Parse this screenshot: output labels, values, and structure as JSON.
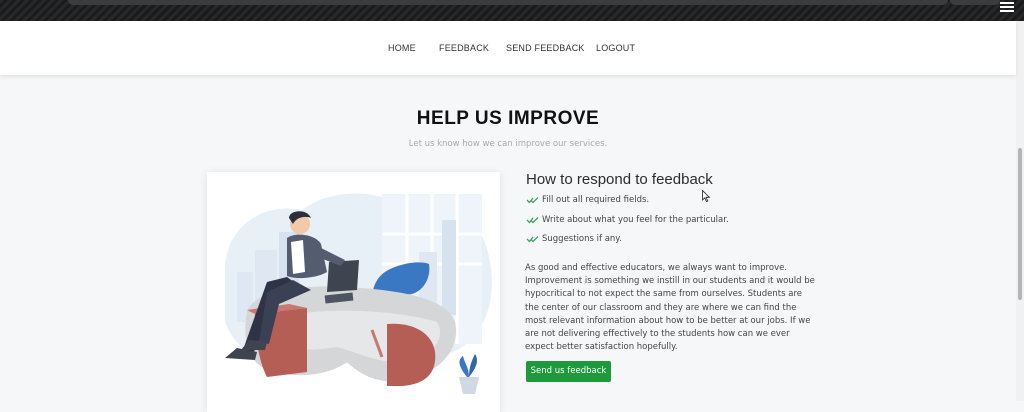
{
  "nav": {
    "items": [
      {
        "label": "HOME"
      },
      {
        "label": "FEEDBACK"
      },
      {
        "label": "SEND FEEDBACK"
      },
      {
        "label": "LOGOUT"
      }
    ]
  },
  "hero": {
    "title": "HELP US IMPROVE",
    "subtitle": "Let us know how we can improve our services."
  },
  "feature": {
    "title": "How to respond to feedback",
    "checklist": [
      {
        "text": "Fill out all required fields."
      },
      {
        "text": "Write about what you feel for the particular."
      },
      {
        "text": "Suggestions if any."
      }
    ],
    "paragraph": "As good and effective educators, we always want to improve. Improvement is something we instill in our students and it would be hypocritical to not expect the same from ourselves. Students are the center of our classroom and they are where we can find the most relevant information about how to be better at our jobs. If we are not delivering effectively to the students how can we ever expect better satisfaction hopefully.",
    "button_label": "Send us feedback"
  },
  "colors": {
    "accent_green": "#1e9a3c",
    "check_green": "#3aa45c",
    "illustration_blue": "#3b78c3",
    "illustration_red": "#b55e56"
  },
  "icons": {
    "check": "double-check-icon",
    "menu": "menu-icon",
    "cursor": "mouse-cursor-icon"
  }
}
